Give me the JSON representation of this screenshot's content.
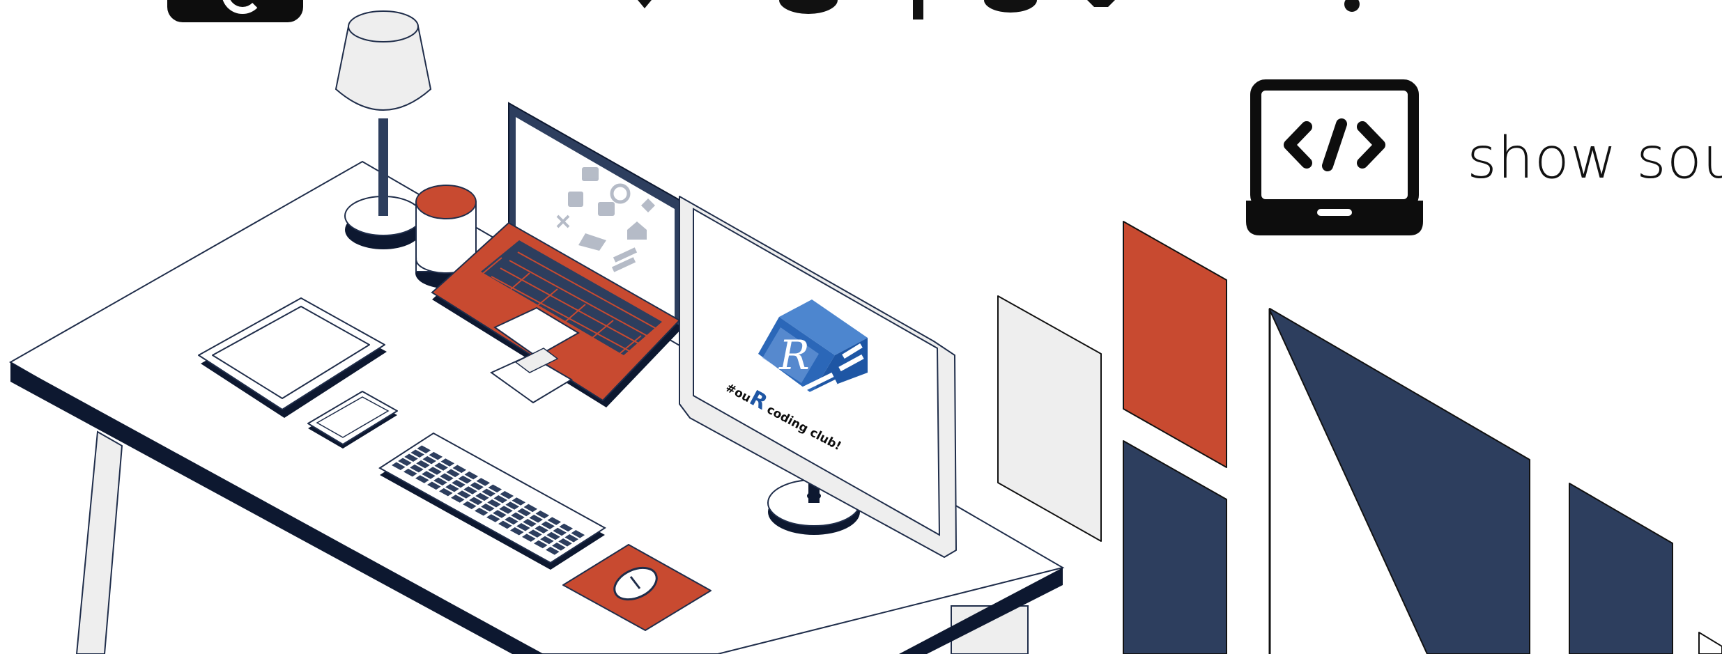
{
  "header": {
    "icon": "home-icon"
  },
  "source_button": {
    "label": "show sou",
    "icon": "code-laptop-icon"
  },
  "monitor_logo": {
    "letter": "R",
    "caption_prefix": "#ou",
    "caption_r": "R",
    "caption_suffix": " coding club!"
  },
  "colors": {
    "navy": "#2d3e5e",
    "rust": "#c84a30",
    "light": "#eeeeee",
    "logo_blue": "#2b67b8",
    "ink": "#111111"
  }
}
